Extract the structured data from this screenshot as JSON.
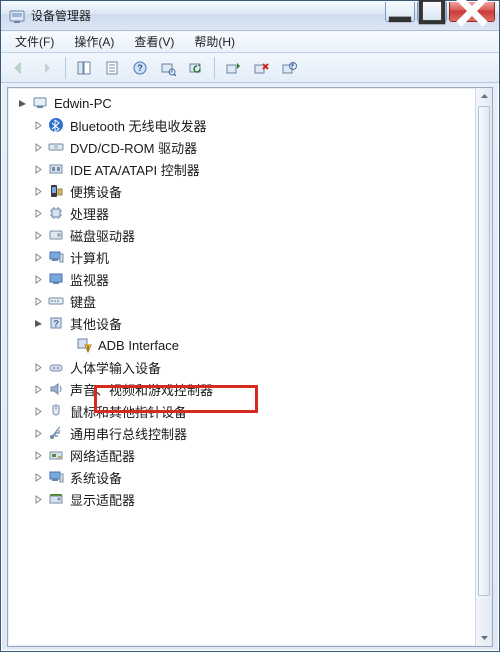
{
  "window": {
    "title": "设备管理器"
  },
  "menu": {
    "file": "文件(F)",
    "action": "操作(A)",
    "view": "查看(V)",
    "help": "帮助(H)"
  },
  "tree": {
    "root": "Edwin-PC",
    "items": [
      {
        "label": "Bluetooth 无线电收发器",
        "icon": "bluetooth"
      },
      {
        "label": "DVD/CD-ROM 驱动器",
        "icon": "disc"
      },
      {
        "label": "IDE ATA/ATAPI 控制器",
        "icon": "ide"
      },
      {
        "label": "便携设备",
        "icon": "portable"
      },
      {
        "label": "处理器",
        "icon": "cpu"
      },
      {
        "label": "磁盘驱动器",
        "icon": "disk"
      },
      {
        "label": "计算机",
        "icon": "computer"
      },
      {
        "label": "监视器",
        "icon": "monitor"
      },
      {
        "label": "键盘",
        "icon": "keyboard"
      },
      {
        "label": "其他设备",
        "icon": "other",
        "expanded": true,
        "children": [
          {
            "label": "ADB Interface",
            "icon": "warning",
            "highlighted": true
          }
        ]
      },
      {
        "label": "人体学输入设备",
        "icon": "hid"
      },
      {
        "label": "声音、视频和游戏控制器",
        "icon": "sound"
      },
      {
        "label": "鼠标和其他指针设备",
        "icon": "mouse"
      },
      {
        "label": "通用串行总线控制器",
        "icon": "usb"
      },
      {
        "label": "网络适配器",
        "icon": "network"
      },
      {
        "label": "系统设备",
        "icon": "system"
      },
      {
        "label": "显示适配器",
        "icon": "display"
      }
    ]
  }
}
